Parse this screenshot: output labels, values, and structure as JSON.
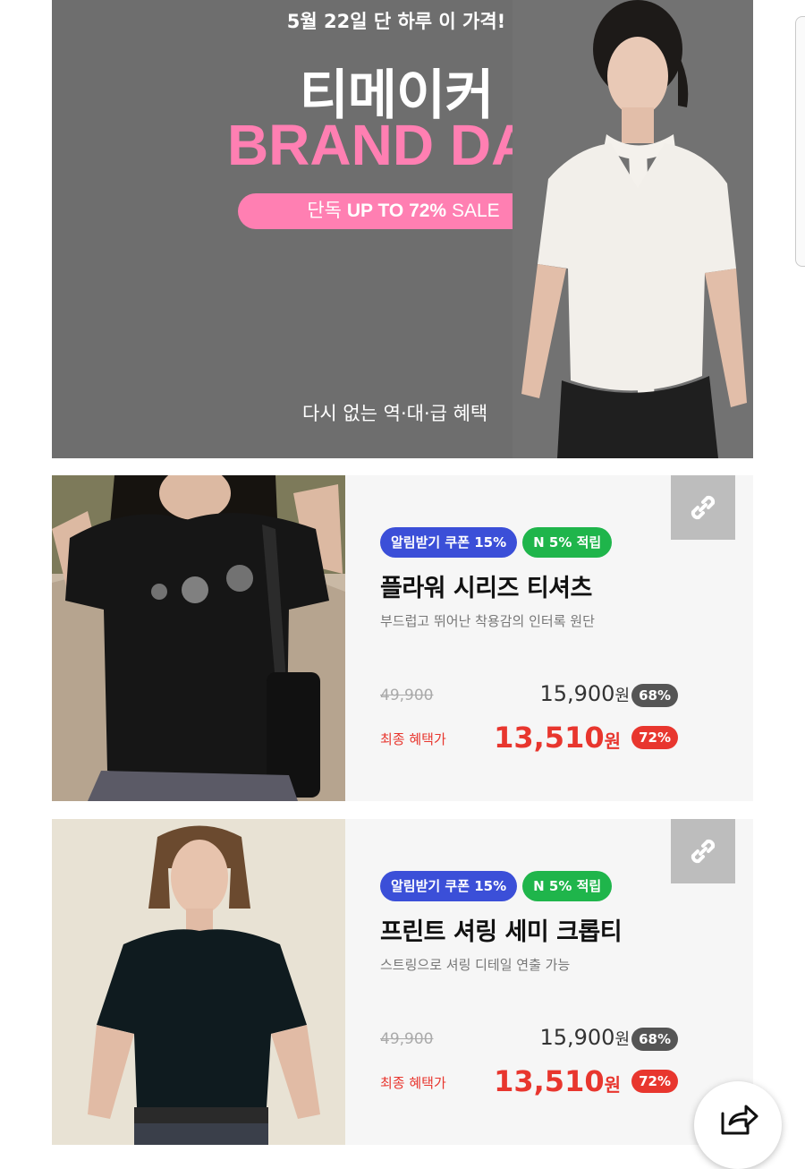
{
  "banner": {
    "date_text": "5월 22일 단 하루 이 가격!",
    "brand_kr": "티메이커",
    "brand_en": "BRAND DAY",
    "pill_prefix": "단독 ",
    "pill_bold": "UP TO 72%",
    "pill_suffix": " SALE",
    "subtext": "다시 없는 역·대·급 혜택",
    "colors": {
      "background": "#6e6e6e",
      "accent_pink": "#ff7fb2"
    }
  },
  "products": [
    {
      "badges": [
        "알림받기 쿠폰 15%",
        "N 5% 적립"
      ],
      "name": "플라워 시리즈 티셔츠",
      "description": "부드럽고 뛰어난 착용감의 인터록 원단",
      "original_price": "49,900",
      "sale_price": "15,900",
      "currency": "원",
      "sale_discount": "68%",
      "final_label": "최종 혜택가",
      "final_price": "13,510",
      "final_discount": "72%",
      "link_icon": "link-icon"
    },
    {
      "badges": [
        "알림받기 쿠폰 15%",
        "N 5% 적립"
      ],
      "name": "프린트 셔링 세미 크롭티",
      "description": "스트링으로 셔링 디테일 연출 가능",
      "original_price": "49,900",
      "sale_price": "15,900",
      "currency": "원",
      "sale_discount": "68%",
      "final_label": "최종 혜택가",
      "final_price": "13,510",
      "final_discount": "72%",
      "link_icon": "link-icon"
    }
  ],
  "floating": {
    "share_icon": "share-icon"
  },
  "colors": {
    "badge_blue": "#3b4fd8",
    "badge_green": "#1fb54b",
    "final_red": "#e8362e"
  }
}
